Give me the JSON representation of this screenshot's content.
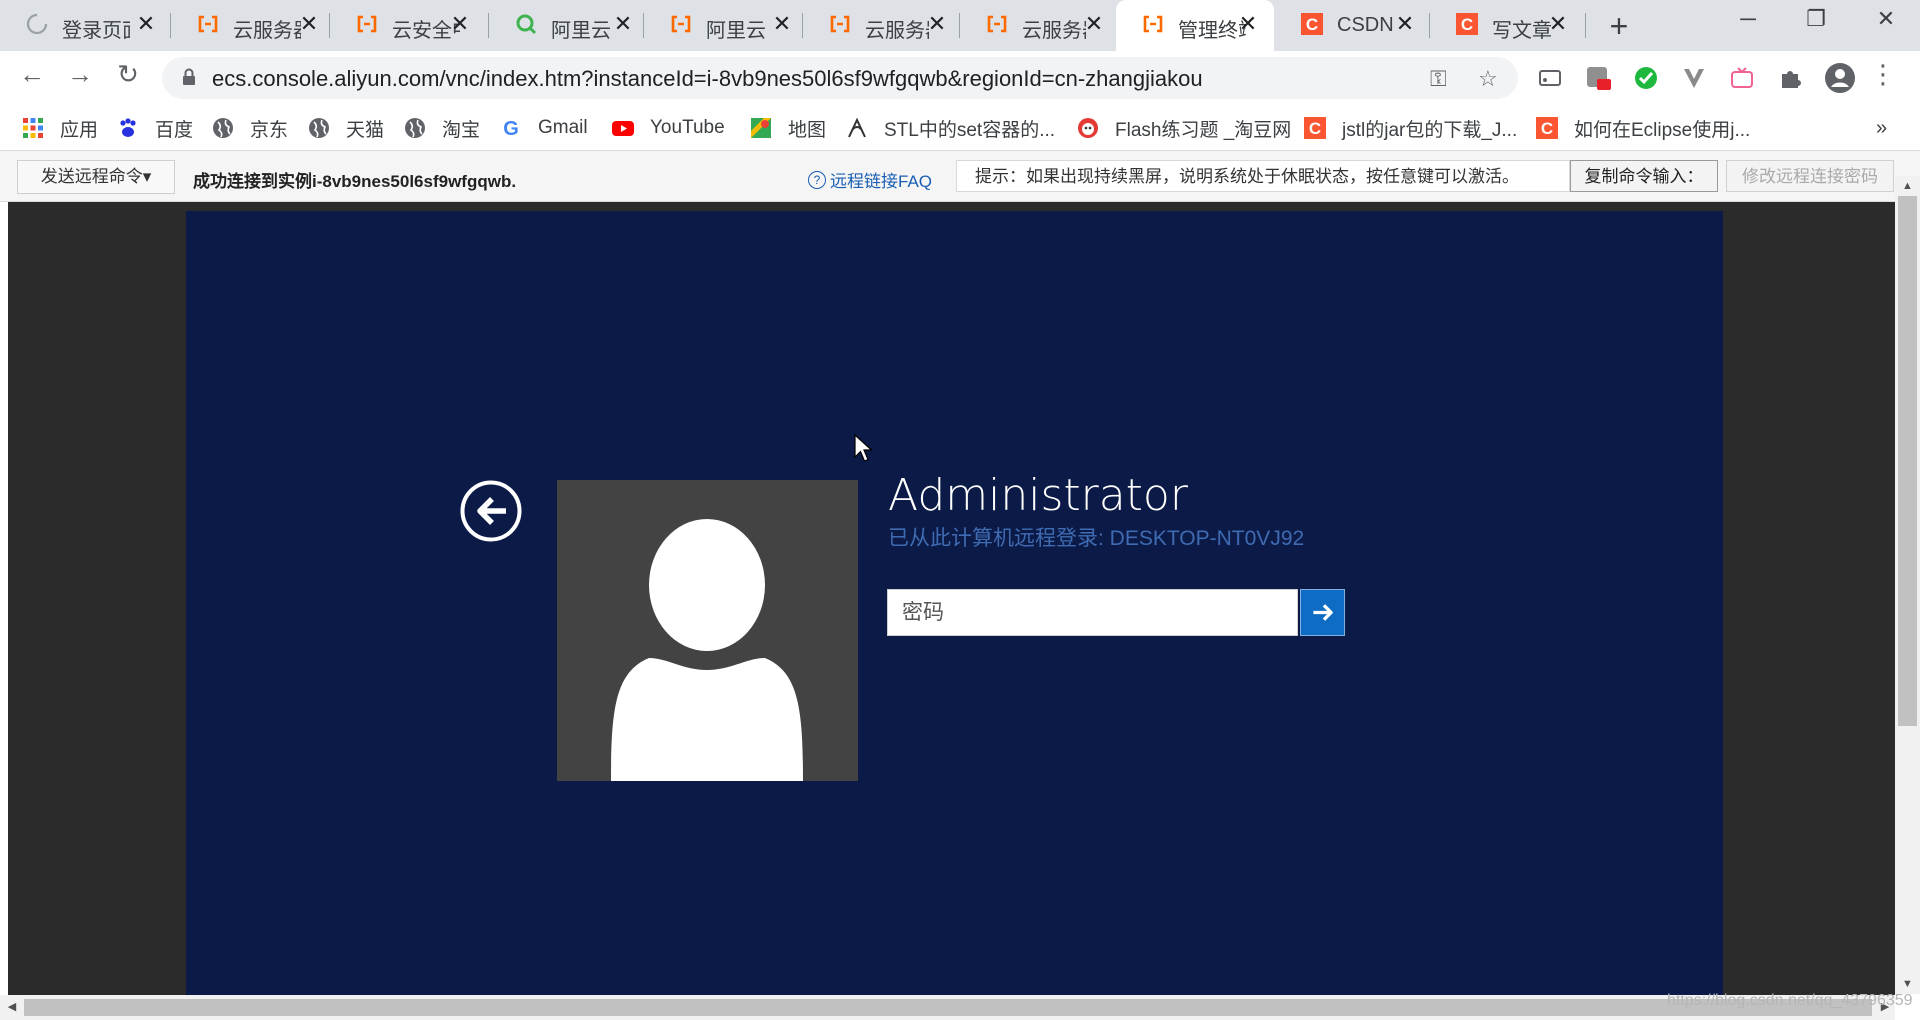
{
  "tabs": [
    {
      "title": "登录页面",
      "icon": "loading-spinner-icon",
      "active": false
    },
    {
      "title": "云服务器",
      "icon": "aliyun-icon",
      "active": false
    },
    {
      "title": "云安全中心",
      "icon": "aliyun-icon",
      "active": false
    },
    {
      "title": "阿里云",
      "icon": "aliyun-search-icon",
      "active": false
    },
    {
      "title": "阿里云",
      "icon": "aliyun-icon",
      "active": false
    },
    {
      "title": "云服务器",
      "icon": "aliyun-icon",
      "active": false
    },
    {
      "title": "云服务器",
      "icon": "aliyun-icon",
      "active": false
    },
    {
      "title": "管理终端",
      "icon": "aliyun-icon",
      "active": true
    },
    {
      "title": "CSDN",
      "icon": "csdn-icon",
      "active": false
    },
    {
      "title": "写文章",
      "icon": "csdn-icon",
      "active": false
    }
  ],
  "address_bar": {
    "url": "ecs.console.aliyun.com/vnc/index.htm?instanceId=i-8vb9nes50l6sf9wfgqwb&regionId=cn-zhangjiakou"
  },
  "bookmarks": [
    {
      "label": "应用",
      "icon": "apps-grid-icon"
    },
    {
      "label": "百度",
      "icon": "baidu-paw-icon"
    },
    {
      "label": "京东",
      "icon": "globe-icon"
    },
    {
      "label": "天猫",
      "icon": "globe-icon"
    },
    {
      "label": "淘宝",
      "icon": "globe-icon"
    },
    {
      "label": "Gmail",
      "icon": "google-icon"
    },
    {
      "label": "YouTube",
      "icon": "youtube-icon"
    },
    {
      "label": "地图",
      "icon": "maps-icon"
    },
    {
      "label": "STL中的set容器的...",
      "icon": "stl-icon"
    },
    {
      "label": "Flash练习题 _淘豆网",
      "icon": "taodou-icon"
    },
    {
      "label": "jstl的jar包的下载_J...",
      "icon": "csdn-icon"
    },
    {
      "label": "如何在Eclipse使用j...",
      "icon": "csdn-icon"
    }
  ],
  "command_bar": {
    "send_command": "发送远程命令",
    "status": "成功连接到实例i-8vb9nes50l6sf9wfgqwb.",
    "faq": "远程链接FAQ",
    "hint": "提示：如果出现持续黑屏，说明系统处于休眠状态，按任意键可以激活。",
    "copy_command": "复制命令输入：",
    "change_password": "修改远程连接密码"
  },
  "login": {
    "user_name": "Administrator",
    "subtitle": "已从此计算机远程登录: DESKTOP-NT0VJ92",
    "password_placeholder": "密码"
  },
  "watermark": "https://blog.csdn.net/qq_43796359",
  "colors": {
    "vnc_background": "#0b1a46",
    "aliyun_orange": "#ff6a00",
    "csdn_red": "#fc5531",
    "submit_blue": "#0e6cc5"
  }
}
